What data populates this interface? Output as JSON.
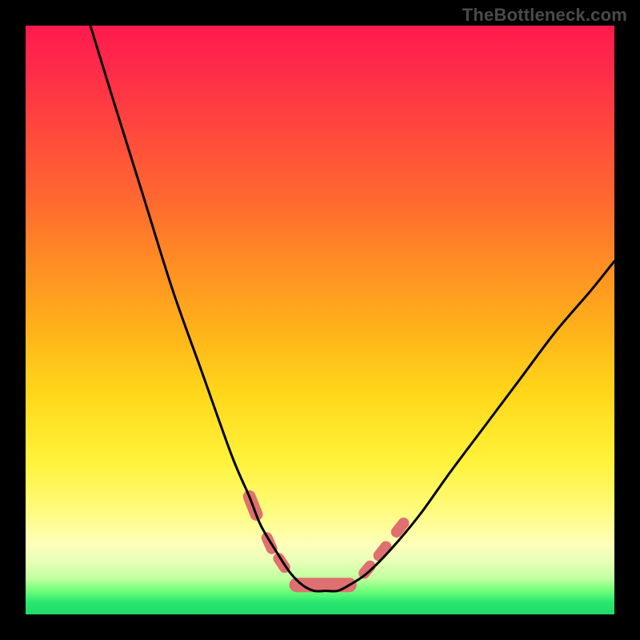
{
  "watermark": {
    "text": "TheBottleneck.com"
  },
  "chart_data": {
    "type": "line",
    "title": "",
    "xlabel": "",
    "ylabel": "",
    "xlim": [
      0,
      100
    ],
    "ylim": [
      0,
      100
    ],
    "grid": false,
    "axes_visible": false,
    "background": {
      "gradient_direction": "top-to-bottom",
      "stops": [
        {
          "pos": 0.0,
          "color": "#ff1a4d"
        },
        {
          "pos": 0.3,
          "color": "#ff6a2f"
        },
        {
          "pos": 0.52,
          "color": "#ffb31a"
        },
        {
          "pos": 0.74,
          "color": "#fff23a"
        },
        {
          "pos": 0.88,
          "color": "#fdffb8"
        },
        {
          "pos": 0.96,
          "color": "#6eff7a"
        },
        {
          "pos": 1.0,
          "color": "#1fdc68"
        }
      ]
    },
    "series": [
      {
        "name": "bottleneck-curve",
        "stroke": "#000000",
        "stroke_width": 3,
        "x": [
          11,
          15,
          20,
          25,
          30,
          35,
          38,
          40,
          43,
          45,
          47,
          49,
          51,
          53,
          55,
          58,
          62,
          67,
          72,
          78,
          84,
          90,
          96,
          100
        ],
        "y": [
          100,
          87,
          71,
          55,
          41,
          27,
          20,
          15,
          10,
          7,
          5,
          4,
          4,
          4,
          5,
          7,
          11,
          17,
          24,
          32,
          40,
          48,
          55,
          60
        ]
      }
    ],
    "marker_segments": [
      {
        "name": "left-top",
        "x0": 38.0,
        "y0": 20.0,
        "x1": 39.2,
        "y1": 17.0,
        "width": 16
      },
      {
        "name": "left-mid",
        "x0": 41.0,
        "y0": 13.0,
        "x1": 41.8,
        "y1": 11.2,
        "width": 14
      },
      {
        "name": "left-low",
        "x0": 43.0,
        "y0": 9.5,
        "x1": 44.0,
        "y1": 8.0,
        "width": 14
      },
      {
        "name": "trough",
        "x0": 46.0,
        "y0": 5.0,
        "x1": 55.0,
        "y1": 5.0,
        "width": 18
      },
      {
        "name": "right-low",
        "x0": 57.5,
        "y0": 7.0,
        "x1": 58.5,
        "y1": 8.2,
        "width": 14
      },
      {
        "name": "right-mid",
        "x0": 60.0,
        "y0": 10.0,
        "x1": 61.2,
        "y1": 11.5,
        "width": 14
      },
      {
        "name": "right-top",
        "x0": 63.0,
        "y0": 14.0,
        "x1": 64.2,
        "y1": 15.5,
        "width": 14
      }
    ],
    "marker_color": "#e07070"
  }
}
